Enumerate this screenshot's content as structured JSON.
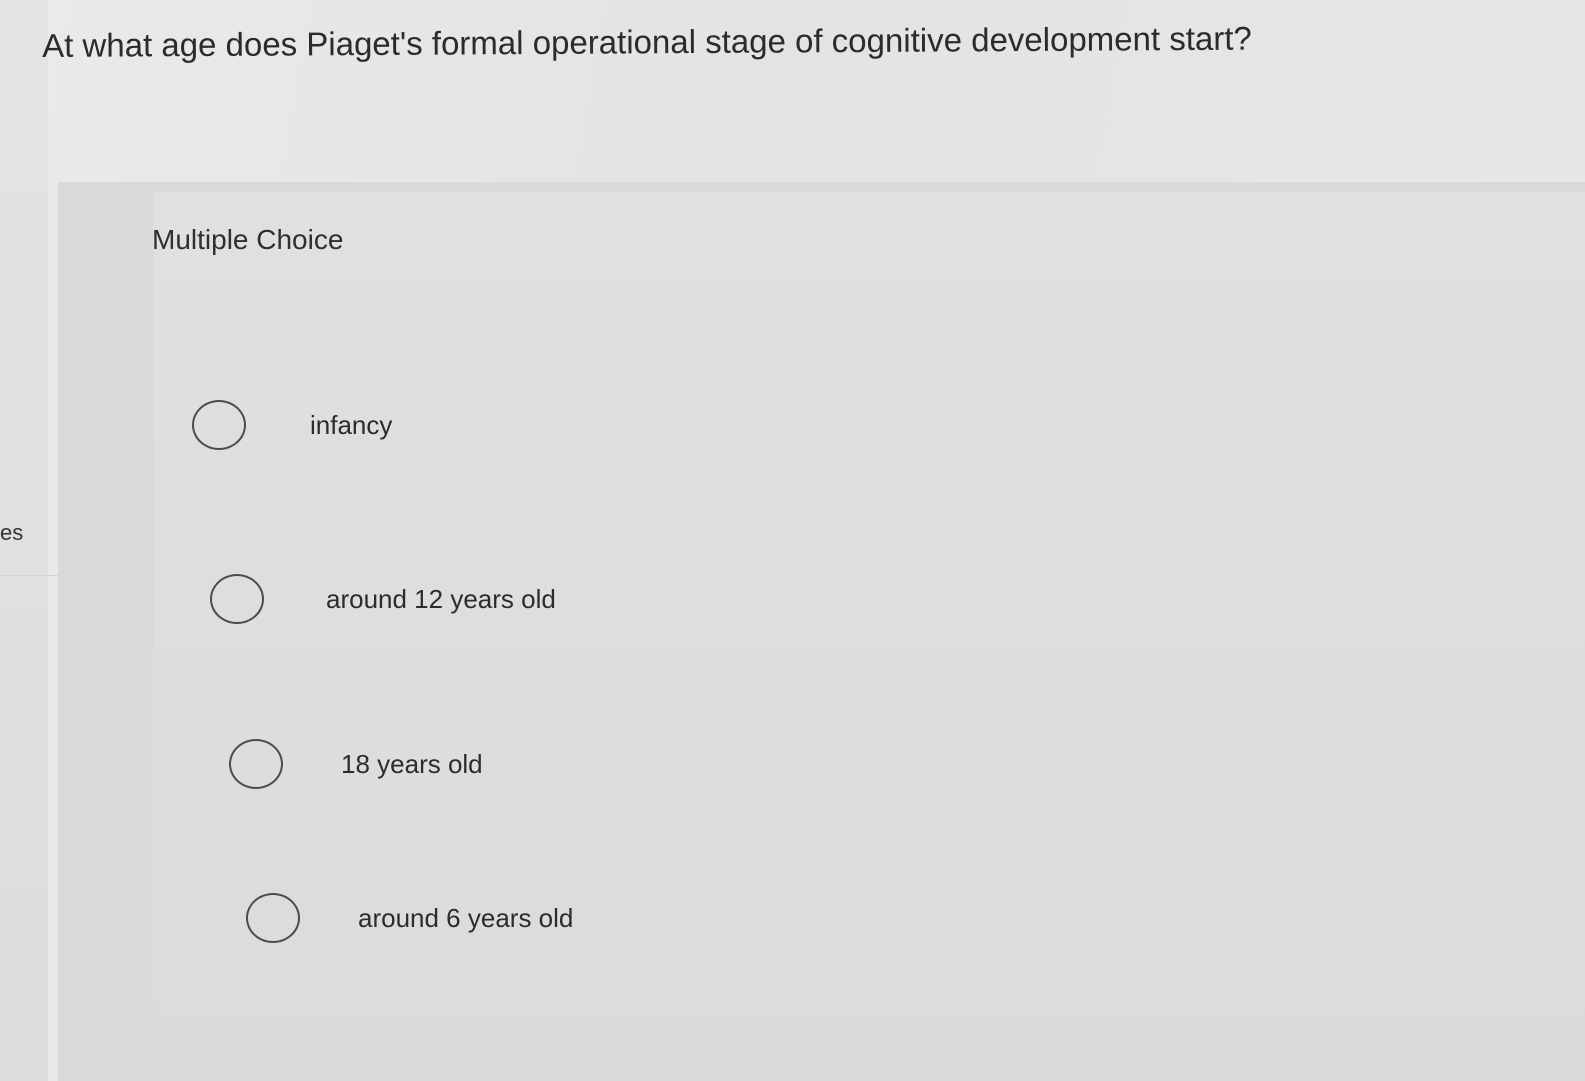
{
  "question": "At what age does Piaget's formal operational stage of cognitive development start?",
  "side_fragment": "es",
  "question_type": "Multiple Choice",
  "options": [
    {
      "label": "infancy",
      "selected": false
    },
    {
      "label": "around 12 years old",
      "selected": false
    },
    {
      "label": "18 years old",
      "selected": false
    },
    {
      "label": "around 6 years old",
      "selected": false
    }
  ]
}
